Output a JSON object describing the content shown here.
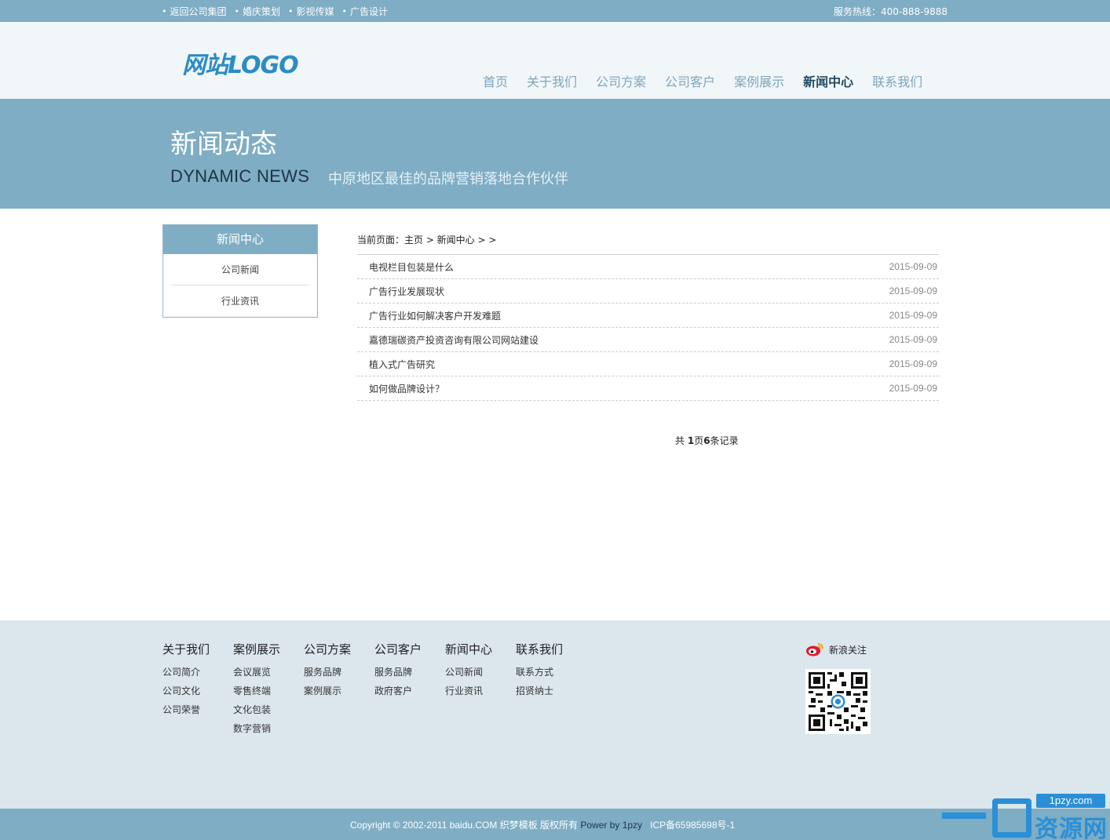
{
  "topbar": {
    "links": [
      "返回公司集团",
      "婚庆策划",
      "影视传媒",
      "广告设计"
    ],
    "hotline": "服务热线：400-888-9888"
  },
  "header": {
    "logo": "网站LOGO",
    "nav": [
      "首页",
      "关于我们",
      "公司方案",
      "公司客户",
      "案例展示",
      "新闻中心",
      "联系我们"
    ],
    "active_nav": "新闻中心"
  },
  "banner": {
    "title_cn": "新闻动态",
    "title_en": "DYNAMIC NEWS",
    "slogan": "中原地区最佳的品牌营销落地合作伙伴"
  },
  "sidebar": {
    "title": "新闻中心",
    "items": [
      "公司新闻",
      "行业资讯"
    ]
  },
  "main": {
    "breadcrumb": "当前页面：主页 > 新闻中心 > >",
    "news": [
      {
        "title": "电视栏目包装是什么",
        "date": "2015-09-09"
      },
      {
        "title": "广告行业发展现状",
        "date": "2015-09-09"
      },
      {
        "title": "广告行业如何解决客户开发难题",
        "date": "2015-09-09"
      },
      {
        "title": "嘉德瑞碳资产投资咨询有限公司网站建设",
        "date": "2015-09-09"
      },
      {
        "title": "植入式广告研究",
        "date": "2015-09-09"
      },
      {
        "title": "如何做品牌设计？",
        "date": "2015-09-09"
      }
    ],
    "pager": {
      "prefix": "共 ",
      "pages": "1",
      "mid": "页",
      "records": "6",
      "suffix": "条记录"
    }
  },
  "footer": {
    "columns": [
      {
        "title": "关于我们",
        "links": [
          "公司简介",
          "公司文化",
          "公司荣誉"
        ]
      },
      {
        "title": "案例展示",
        "links": [
          "会议展览",
          "零售终端",
          "文化包装",
          "数字营销"
        ]
      },
      {
        "title": "公司方案",
        "links": [
          "服务品牌",
          "案例展示"
        ]
      },
      {
        "title": "公司客户",
        "links": [
          "服务品牌",
          "政府客户"
        ]
      },
      {
        "title": "新闻中心",
        "links": [
          "公司新闻",
          "行业资讯"
        ]
      },
      {
        "title": "联系我们",
        "links": [
          "联系方式",
          "招贤纳士"
        ]
      }
    ],
    "weibo_label": "新浪关注",
    "copyright": "Copyright © 2002-2011 baidu.COM 织梦模板 版权所有 ",
    "power": "Power by 1pzy",
    "icp": "   ICP备65985698号-1"
  },
  "watermark": {
    "url": "1pzy.com",
    "text": "资源网"
  },
  "colors": {
    "accent": "#7fadc4",
    "header_bg": "#f1f6f9",
    "footer_bg": "#dbe7ed",
    "active_nav": "#244a63",
    "logo": "#2b8cc6"
  }
}
